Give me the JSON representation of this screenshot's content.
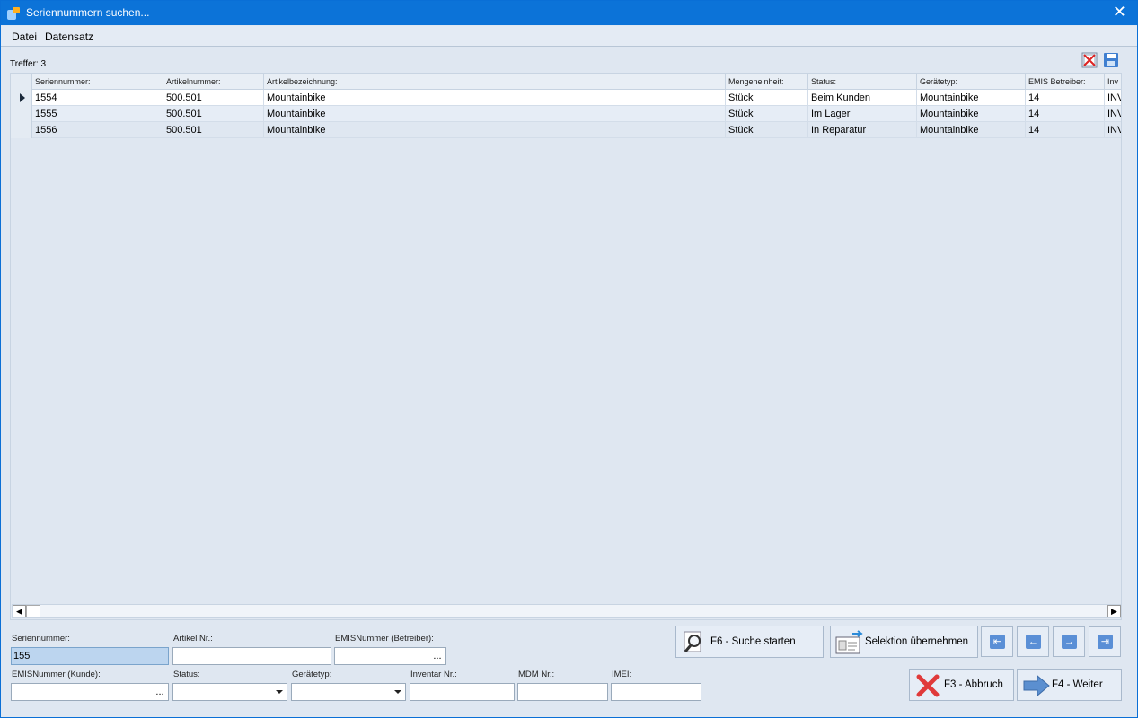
{
  "window": {
    "title": "Seriennummern suchen..."
  },
  "menu": {
    "file": "Datei",
    "record": "Datensatz"
  },
  "results": {
    "label": "Treffer: 3"
  },
  "grid": {
    "headers": [
      "Seriennummer:",
      "Artikelnummer:",
      "Artikelbezeichnung:",
      "Mengeneinheit:",
      "Status:",
      "Gerätetyp:",
      "EMIS Betreiber:",
      "Inv"
    ],
    "rows": [
      [
        "1554",
        "500.501",
        "Mountainbike",
        "Stück",
        "Beim Kunden",
        "Mountainbike",
        "14",
        "INV"
      ],
      [
        "1555",
        "500.501",
        "Mountainbike",
        "Stück",
        "Im Lager",
        "Mountainbike",
        "14",
        "INV"
      ],
      [
        "1556",
        "500.501",
        "Mountainbike",
        "Stück",
        "In Reparatur",
        "Mountainbike",
        "14",
        "INV"
      ]
    ]
  },
  "filters": {
    "serial_label": "Seriennummer:",
    "serial_value": "155",
    "article_label": "Artikel Nr.:",
    "article_value": "",
    "emis_operator_label": "EMISNummer (Betreiber):",
    "emis_operator_value": "",
    "emis_customer_label": "EMISNummer (Kunde):",
    "emis_customer_value": "",
    "status_label": "Status:",
    "status_value": "",
    "device_type_label": "Gerätetyp:",
    "device_type_value": "",
    "inventory_label": "Inventar Nr.:",
    "inventory_value": "",
    "mdm_label": "MDM Nr.:",
    "mdm_value": "",
    "imei_label": "IMEI:",
    "imei_value": "",
    "ellipsis": "..."
  },
  "buttons": {
    "search": "F6 - Suche starten",
    "apply_selection": "Selektion übernehmen",
    "cancel": "F3 - Abbruch",
    "next": "F4 - Weiter"
  },
  "icons": {
    "app": "app-icon",
    "close": "close-icon",
    "search": "magnifier-icon",
    "cancel": "red-x-icon",
    "next": "arrow-right-icon"
  },
  "colors": {
    "titlebar": "#0c73d8",
    "window_bg": "#dfe7f1",
    "active_input": "#bcd5ef"
  }
}
